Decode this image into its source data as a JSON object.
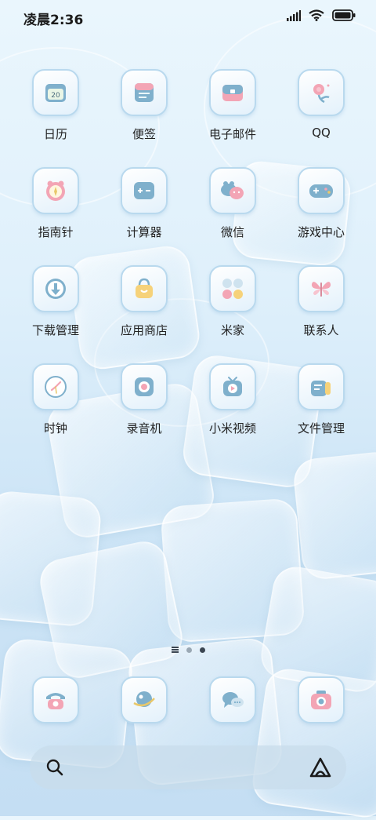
{
  "status_bar": {
    "time": "凌晨2:36",
    "icons": [
      "signal-icon",
      "wifi-icon",
      "battery-icon"
    ]
  },
  "apps": [
    {
      "label": "日历",
      "icon": "calendar-icon",
      "badge_text": "20"
    },
    {
      "label": "便签",
      "icon": "notes-icon"
    },
    {
      "label": "电子邮件",
      "icon": "email-icon"
    },
    {
      "label": "QQ",
      "icon": "qq-flower-icon"
    },
    {
      "label": "指南针",
      "icon": "compass-icon"
    },
    {
      "label": "计算器",
      "icon": "calculator-icon"
    },
    {
      "label": "微信",
      "icon": "wechat-icon"
    },
    {
      "label": "游戏中心",
      "icon": "gamepad-icon"
    },
    {
      "label": "下载管理",
      "icon": "download-icon"
    },
    {
      "label": "应用商店",
      "icon": "store-bag-icon"
    },
    {
      "label": "米家",
      "icon": "mijia-icon"
    },
    {
      "label": "联系人",
      "icon": "contacts-butterfly-icon"
    },
    {
      "label": "时钟",
      "icon": "clock-icon"
    },
    {
      "label": "录音机",
      "icon": "recorder-icon"
    },
    {
      "label": "小米视频",
      "icon": "video-icon"
    },
    {
      "label": "文件管理",
      "icon": "file-manager-icon"
    }
  ],
  "dock": [
    {
      "icon": "phone-icon"
    },
    {
      "icon": "browser-planet-icon"
    },
    {
      "icon": "messages-icon"
    },
    {
      "icon": "camera-icon"
    }
  ],
  "pager": {
    "page_count": 2,
    "active_index": 1
  },
  "colors": {
    "icon_border": "#b9d9ee",
    "accent_pink": "#f3a5b5",
    "accent_blue": "#7fb0cc"
  }
}
